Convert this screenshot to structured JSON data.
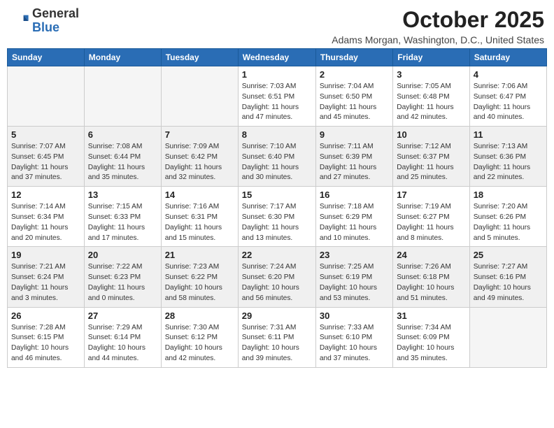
{
  "logo": {
    "general": "General",
    "blue": "Blue"
  },
  "header": {
    "month": "October 2025",
    "location": "Adams Morgan, Washington, D.C., United States"
  },
  "days_of_week": [
    "Sunday",
    "Monday",
    "Tuesday",
    "Wednesday",
    "Thursday",
    "Friday",
    "Saturday"
  ],
  "weeks": [
    [
      {
        "day": "",
        "info": ""
      },
      {
        "day": "",
        "info": ""
      },
      {
        "day": "",
        "info": ""
      },
      {
        "day": "1",
        "info": "Sunrise: 7:03 AM\nSunset: 6:51 PM\nDaylight: 11 hours\nand 47 minutes."
      },
      {
        "day": "2",
        "info": "Sunrise: 7:04 AM\nSunset: 6:50 PM\nDaylight: 11 hours\nand 45 minutes."
      },
      {
        "day": "3",
        "info": "Sunrise: 7:05 AM\nSunset: 6:48 PM\nDaylight: 11 hours\nand 42 minutes."
      },
      {
        "day": "4",
        "info": "Sunrise: 7:06 AM\nSunset: 6:47 PM\nDaylight: 11 hours\nand 40 minutes."
      }
    ],
    [
      {
        "day": "5",
        "info": "Sunrise: 7:07 AM\nSunset: 6:45 PM\nDaylight: 11 hours\nand 37 minutes."
      },
      {
        "day": "6",
        "info": "Sunrise: 7:08 AM\nSunset: 6:44 PM\nDaylight: 11 hours\nand 35 minutes."
      },
      {
        "day": "7",
        "info": "Sunrise: 7:09 AM\nSunset: 6:42 PM\nDaylight: 11 hours\nand 32 minutes."
      },
      {
        "day": "8",
        "info": "Sunrise: 7:10 AM\nSunset: 6:40 PM\nDaylight: 11 hours\nand 30 minutes."
      },
      {
        "day": "9",
        "info": "Sunrise: 7:11 AM\nSunset: 6:39 PM\nDaylight: 11 hours\nand 27 minutes."
      },
      {
        "day": "10",
        "info": "Sunrise: 7:12 AM\nSunset: 6:37 PM\nDaylight: 11 hours\nand 25 minutes."
      },
      {
        "day": "11",
        "info": "Sunrise: 7:13 AM\nSunset: 6:36 PM\nDaylight: 11 hours\nand 22 minutes."
      }
    ],
    [
      {
        "day": "12",
        "info": "Sunrise: 7:14 AM\nSunset: 6:34 PM\nDaylight: 11 hours\nand 20 minutes."
      },
      {
        "day": "13",
        "info": "Sunrise: 7:15 AM\nSunset: 6:33 PM\nDaylight: 11 hours\nand 17 minutes."
      },
      {
        "day": "14",
        "info": "Sunrise: 7:16 AM\nSunset: 6:31 PM\nDaylight: 11 hours\nand 15 minutes."
      },
      {
        "day": "15",
        "info": "Sunrise: 7:17 AM\nSunset: 6:30 PM\nDaylight: 11 hours\nand 13 minutes."
      },
      {
        "day": "16",
        "info": "Sunrise: 7:18 AM\nSunset: 6:29 PM\nDaylight: 11 hours\nand 10 minutes."
      },
      {
        "day": "17",
        "info": "Sunrise: 7:19 AM\nSunset: 6:27 PM\nDaylight: 11 hours\nand 8 minutes."
      },
      {
        "day": "18",
        "info": "Sunrise: 7:20 AM\nSunset: 6:26 PM\nDaylight: 11 hours\nand 5 minutes."
      }
    ],
    [
      {
        "day": "19",
        "info": "Sunrise: 7:21 AM\nSunset: 6:24 PM\nDaylight: 11 hours\nand 3 minutes."
      },
      {
        "day": "20",
        "info": "Sunrise: 7:22 AM\nSunset: 6:23 PM\nDaylight: 11 hours\nand 0 minutes."
      },
      {
        "day": "21",
        "info": "Sunrise: 7:23 AM\nSunset: 6:22 PM\nDaylight: 10 hours\nand 58 minutes."
      },
      {
        "day": "22",
        "info": "Sunrise: 7:24 AM\nSunset: 6:20 PM\nDaylight: 10 hours\nand 56 minutes."
      },
      {
        "day": "23",
        "info": "Sunrise: 7:25 AM\nSunset: 6:19 PM\nDaylight: 10 hours\nand 53 minutes."
      },
      {
        "day": "24",
        "info": "Sunrise: 7:26 AM\nSunset: 6:18 PM\nDaylight: 10 hours\nand 51 minutes."
      },
      {
        "day": "25",
        "info": "Sunrise: 7:27 AM\nSunset: 6:16 PM\nDaylight: 10 hours\nand 49 minutes."
      }
    ],
    [
      {
        "day": "26",
        "info": "Sunrise: 7:28 AM\nSunset: 6:15 PM\nDaylight: 10 hours\nand 46 minutes."
      },
      {
        "day": "27",
        "info": "Sunrise: 7:29 AM\nSunset: 6:14 PM\nDaylight: 10 hours\nand 44 minutes."
      },
      {
        "day": "28",
        "info": "Sunrise: 7:30 AM\nSunset: 6:12 PM\nDaylight: 10 hours\nand 42 minutes."
      },
      {
        "day": "29",
        "info": "Sunrise: 7:31 AM\nSunset: 6:11 PM\nDaylight: 10 hours\nand 39 minutes."
      },
      {
        "day": "30",
        "info": "Sunrise: 7:33 AM\nSunset: 6:10 PM\nDaylight: 10 hours\nand 37 minutes."
      },
      {
        "day": "31",
        "info": "Sunrise: 7:34 AM\nSunset: 6:09 PM\nDaylight: 10 hours\nand 35 minutes."
      },
      {
        "day": "",
        "info": ""
      }
    ]
  ]
}
